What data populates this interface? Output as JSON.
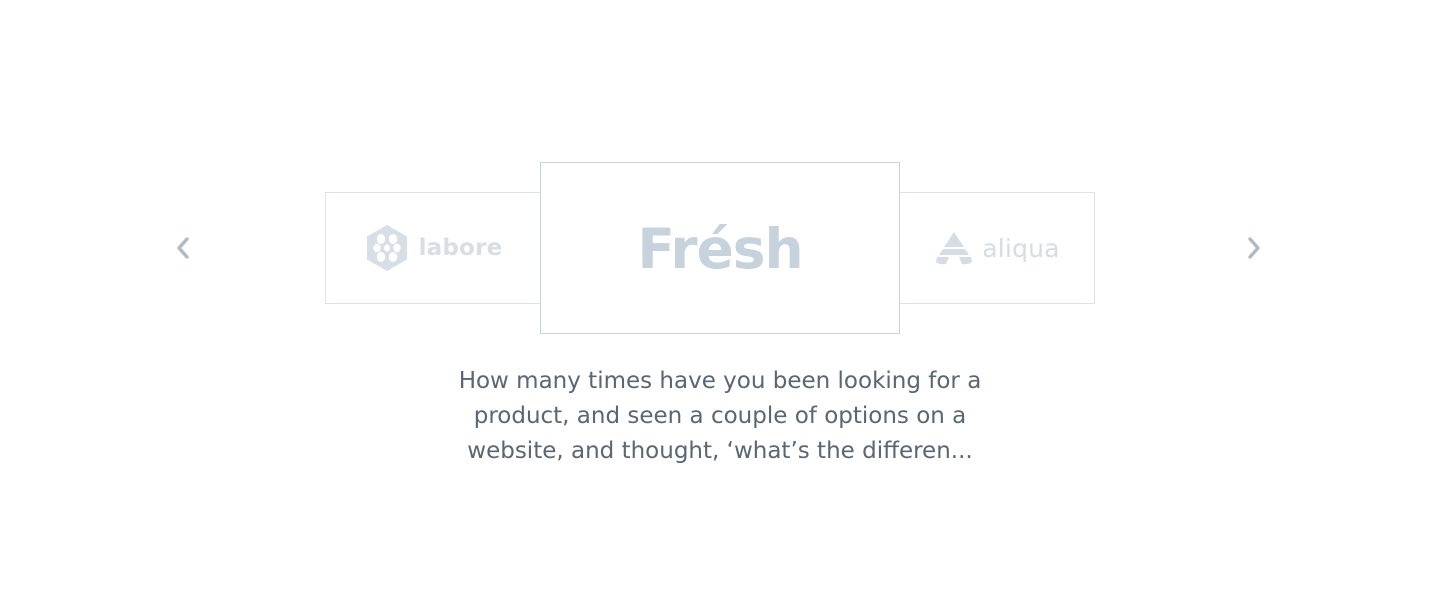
{
  "carousel": {
    "prev_icon": "chevron-left-icon",
    "next_icon": "chevron-right-icon",
    "logos": [
      {
        "text": "labore",
        "icon": "hexagon-logo-icon",
        "position": "left"
      },
      {
        "text": "Frésh",
        "icon": "none",
        "position": "center"
      },
      {
        "text": "aliqua",
        "icon": "triangle-stripes-logo-icon",
        "position": "right"
      }
    ],
    "testimonial": "How many times have you been looking for a product, and seen a couple of options on a website, and thought, ‘what’s the differen..."
  },
  "colors": {
    "arrow": "#aebbc7",
    "card_border": "#dde3e8",
    "card_border_active": "#c9d2da",
    "logo_inactive": "#d7dee5",
    "logo_active": "#c6d2dc",
    "text": "#5a6673"
  }
}
